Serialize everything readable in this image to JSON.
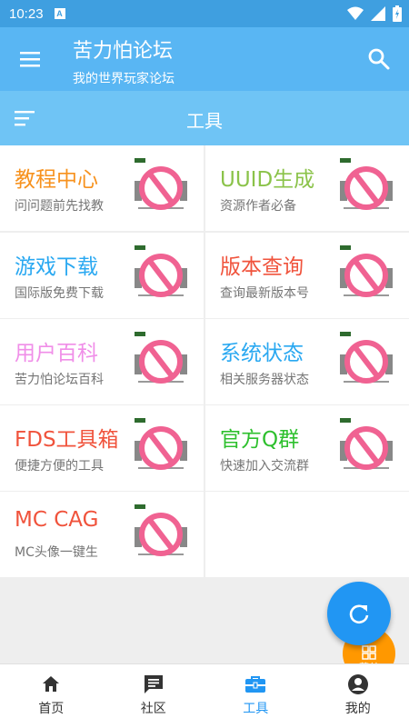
{
  "status_bar": {
    "time": "10:23",
    "notification": "A"
  },
  "app_bar": {
    "title": "苦力怕论坛",
    "subtitle": "我的世界玩家论坛"
  },
  "section": {
    "title": "工具"
  },
  "tools": [
    {
      "title": "教程中心",
      "desc": "问问题前先找教",
      "color": "#f7921e"
    },
    {
      "title": "UUID生成",
      "desc": "资源作者必备",
      "color": "#8bc34a"
    },
    {
      "title": "游戏下载",
      "desc": "国际版免费下载",
      "color": "#29a8f1"
    },
    {
      "title": "版本查询",
      "desc": "查询最新版本号",
      "color": "#f0533c"
    },
    {
      "title": "用户百科",
      "desc": "苦力怕论坛百科",
      "color": "#f08ee8"
    },
    {
      "title": "系统状态",
      "desc": "相关服务器状态",
      "color": "#29a8f1"
    },
    {
      "title": "FDS工具箱",
      "desc": "便捷方便的工具",
      "color": "#f0533c"
    },
    {
      "title": "官方Q群",
      "desc": "快速加入交流群",
      "color": "#2ec02e"
    },
    {
      "title": "MC CAG",
      "desc": "MC头像一键生",
      "color": "#f0533c"
    }
  ],
  "mini_fab": {
    "label": "菜单"
  },
  "bottom_nav": [
    {
      "label": "首页",
      "icon": "home-icon"
    },
    {
      "label": "社区",
      "icon": "chat-icon"
    },
    {
      "label": "工具",
      "icon": "toolbox-icon",
      "active": true
    },
    {
      "label": "我的",
      "icon": "account-icon"
    }
  ],
  "colors": {
    "primary": "#59b6f3",
    "accent": "#2196f3",
    "fab_secondary": "#ff9800"
  }
}
